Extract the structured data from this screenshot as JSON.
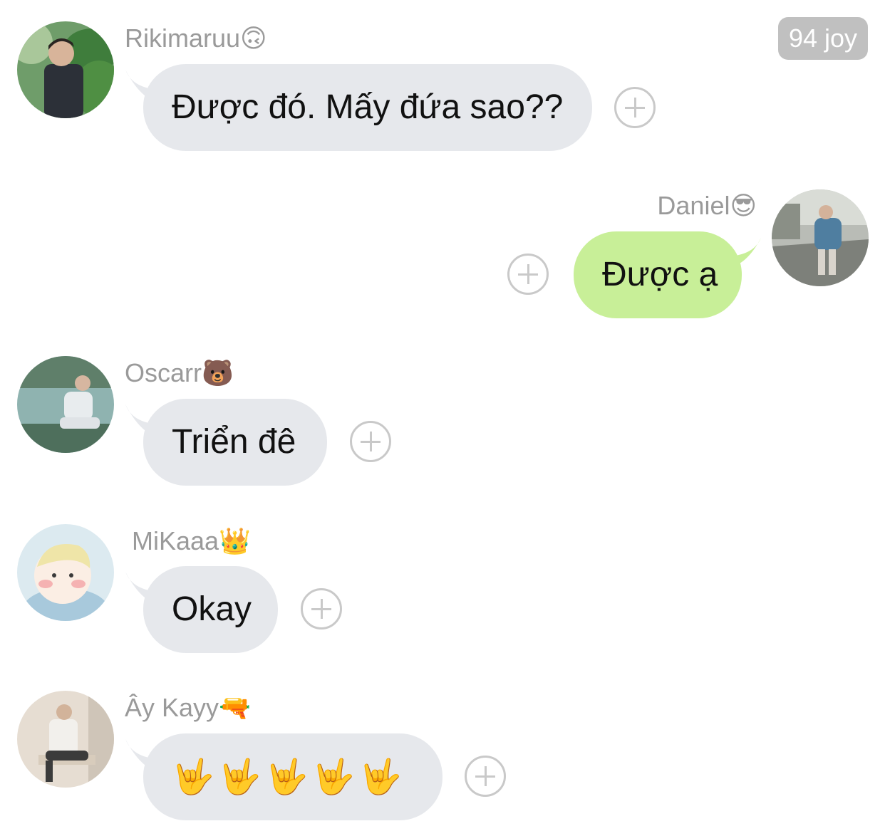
{
  "badge": {
    "label": "94 joy"
  },
  "messages": [
    {
      "sender": "Rikimaruu",
      "sender_emoji": "🙃",
      "text": "Được đó. Mấy đứa sao??",
      "avatar_icon": "avatar-photo-man-plants-icon"
    },
    {
      "sender": "Daniel",
      "sender_emoji": "😎",
      "text": "Được ạ",
      "avatar_icon": "avatar-photo-street-icon"
    },
    {
      "sender": "Oscarr",
      "sender_emoji": "🐻",
      "text": "Triển đê",
      "avatar_icon": "avatar-photo-lake-icon"
    },
    {
      "sender": "MiKaaa",
      "sender_emoji": "👑",
      "text": "Okay",
      "avatar_icon": "avatar-cartoon-baby-icon"
    },
    {
      "sender": "Ây Kayy",
      "sender_emoji": "🔫",
      "text": "🤟🤟🤟🤟🤟",
      "avatar_icon": "avatar-photo-seated-man-icon"
    }
  ],
  "colors": {
    "incoming_bubble": "#e6e8ec",
    "outgoing_bubble": "#c8ef98",
    "name_text": "#9a9a9a",
    "badge_bg": "#c0c0c0"
  }
}
